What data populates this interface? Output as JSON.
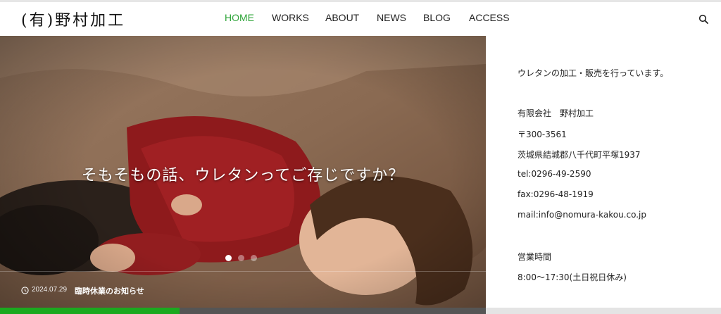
{
  "header": {
    "logo": "(有)野村加工",
    "nav": [
      {
        "label": "HOME",
        "active": true
      },
      {
        "label": "WORKS",
        "active": false
      },
      {
        "label": "ABOUT",
        "active": false
      },
      {
        "label": "NEWS",
        "active": false
      },
      {
        "label": "BLOG",
        "active": false
      },
      {
        "label": "ACCESS",
        "active": false
      }
    ],
    "search_icon": "search-icon"
  },
  "hero": {
    "caption": "そもそもの話、ウレタンってご存じですか？",
    "slides_count": 3,
    "active_slide": 1,
    "news": {
      "date": "2024.07.29",
      "title": "臨時休業のお知らせ"
    },
    "progress": 0.37
  },
  "sidebar": {
    "tagline": "ウレタンの加工・販売を行っています。",
    "company": "有限会社　野村加工",
    "postal": "〒300-3561",
    "address": "茨城県結城郡八千代町平塚1937",
    "tel": "tel:0296-49-2590",
    "fax": "fax:0296-48-1919",
    "mail": "mail:info@nomura-kakou.co.jp",
    "hours_label": "営業時間",
    "hours": "8:00～17:30(土日祝日休み)"
  },
  "colors": {
    "accent": "#2fa53a",
    "progress": "#1ba91f"
  }
}
